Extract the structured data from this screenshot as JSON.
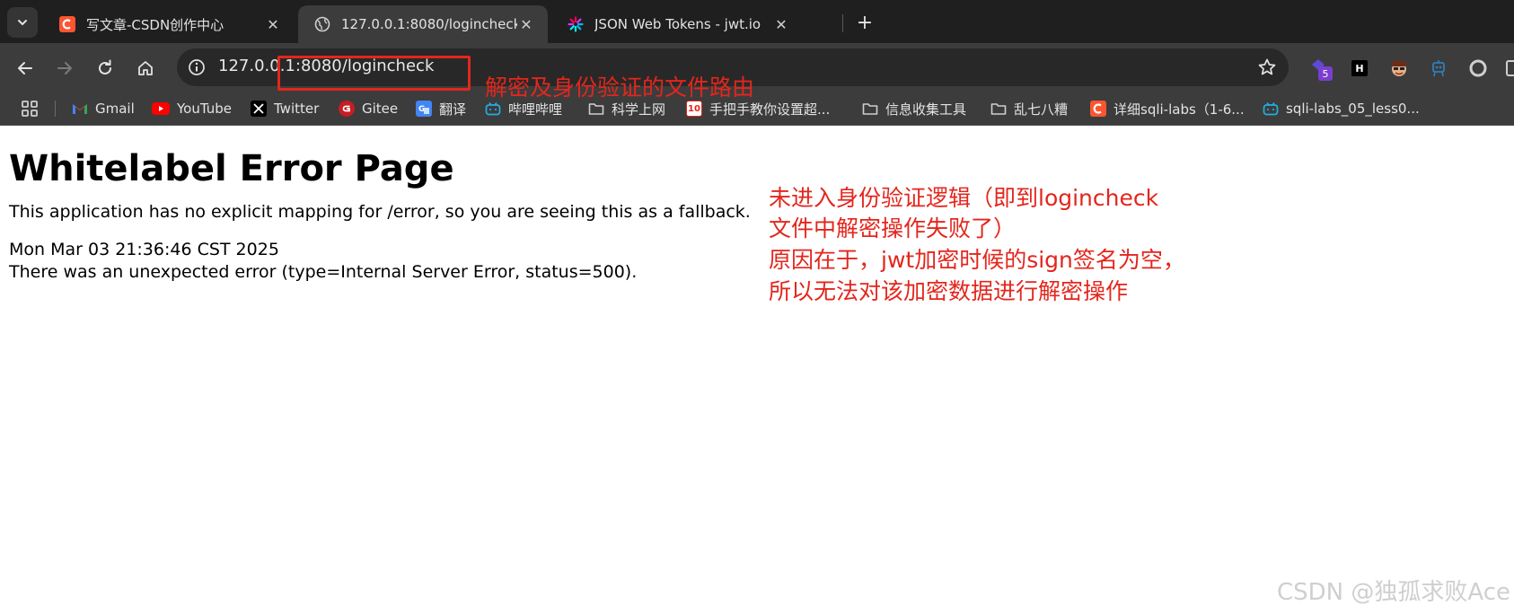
{
  "tabs": [
    {
      "title": "写文章-CSDN创作中心",
      "icon": "csdn-icon",
      "active": false
    },
    {
      "title": "127.0.0.1:8080/logincheck",
      "icon": "globe-icon",
      "active": true
    },
    {
      "title": "JSON Web Tokens - jwt.io",
      "icon": "jwt-icon",
      "active": false
    }
  ],
  "tab_close_glyph": "✕",
  "newtab_glyph": "+",
  "address": {
    "url": "127.0.0.1:8080/logincheck"
  },
  "extensions": {
    "badge": "5",
    "h_label": "H"
  },
  "bookmarks": [
    {
      "label": "Gmail",
      "icon": "gmail-icon"
    },
    {
      "label": "YouTube",
      "icon": "youtube-icon"
    },
    {
      "label": "Twitter",
      "icon": "x-icon"
    },
    {
      "label": "Gitee",
      "icon": "gitee-icon"
    },
    {
      "label": "翻译",
      "icon": "translate-icon"
    },
    {
      "label": "哔哩哔哩",
      "icon": "bilibili-icon"
    },
    {
      "label": "科学上网",
      "icon": "folder-icon"
    },
    {
      "label": "手把手教你设置超...",
      "icon": "sub-icon"
    },
    {
      "label": "信息收集工具",
      "icon": "folder-icon"
    },
    {
      "label": "乱七八糟",
      "icon": "folder-icon"
    },
    {
      "label": "详细sqli-labs（1-6...",
      "icon": "csdn-icon"
    },
    {
      "label": "sqli-labs_05_less0...",
      "icon": "bilibili-icon"
    }
  ],
  "page": {
    "title": "Whitelabel Error Page",
    "message": "This application has no explicit mapping for /error, so you are seeing this as a fallback.",
    "timestamp": "Mon Mar 03 21:36:46 CST 2025",
    "error": "There was an unexpected error (type=Internal Server Error, status=500)."
  },
  "annotations": {
    "url_note": "解密及身份验证的文件路由",
    "lines": [
      "未进入身份验证逻辑（即到logincheck",
      "文件中解密操作失败了）",
      "原因在于，jwt加密时候的sign签名为空，",
      "所以无法对该加密数据进行解密操作"
    ]
  },
  "watermark": "CSDN @独孤求败Ace",
  "colors": {
    "annotation": "#e3261d",
    "chrome_dark": "#1f1f1f",
    "chrome": "#3c3c3c"
  }
}
